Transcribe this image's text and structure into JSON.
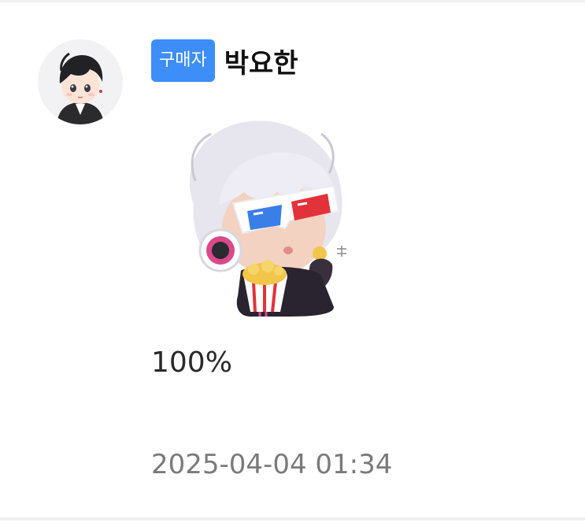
{
  "review": {
    "badge_label": "구매자",
    "user_name": "박요한",
    "avatar_icon": "user-avatar-icon",
    "sticker_icon": "chibi-popcorn-3d-glasses-sticker",
    "text": "100%",
    "date": "2025-04-04 01:34"
  },
  "colors": {
    "badge": "#3d8ef8",
    "divider": "#f0f0f2",
    "date_text": "#7a7a7a"
  }
}
